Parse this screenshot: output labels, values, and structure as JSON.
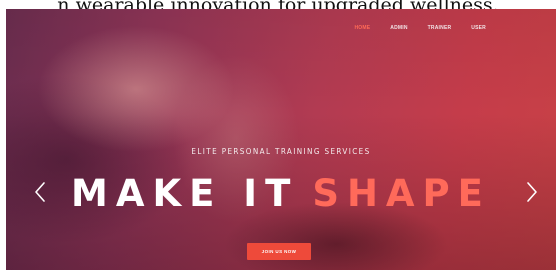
{
  "page": {
    "caption": "n wearable innovation for upgraded wellness."
  },
  "nav": {
    "items": [
      "HOME",
      "ADMIN",
      "TRAINER",
      "USER"
    ],
    "active_color": "#ff6a57"
  },
  "hero": {
    "subtitle": "ELITE PERSONAL TRAINING SERVICES",
    "headline_white": "MAKE IT",
    "headline_accent": "SHAPE",
    "accent_color": "#ff6a5a",
    "cta_label": "JOIN US NOW",
    "prev_icon": "chevron-left-icon",
    "next_icon": "chevron-right-icon"
  }
}
